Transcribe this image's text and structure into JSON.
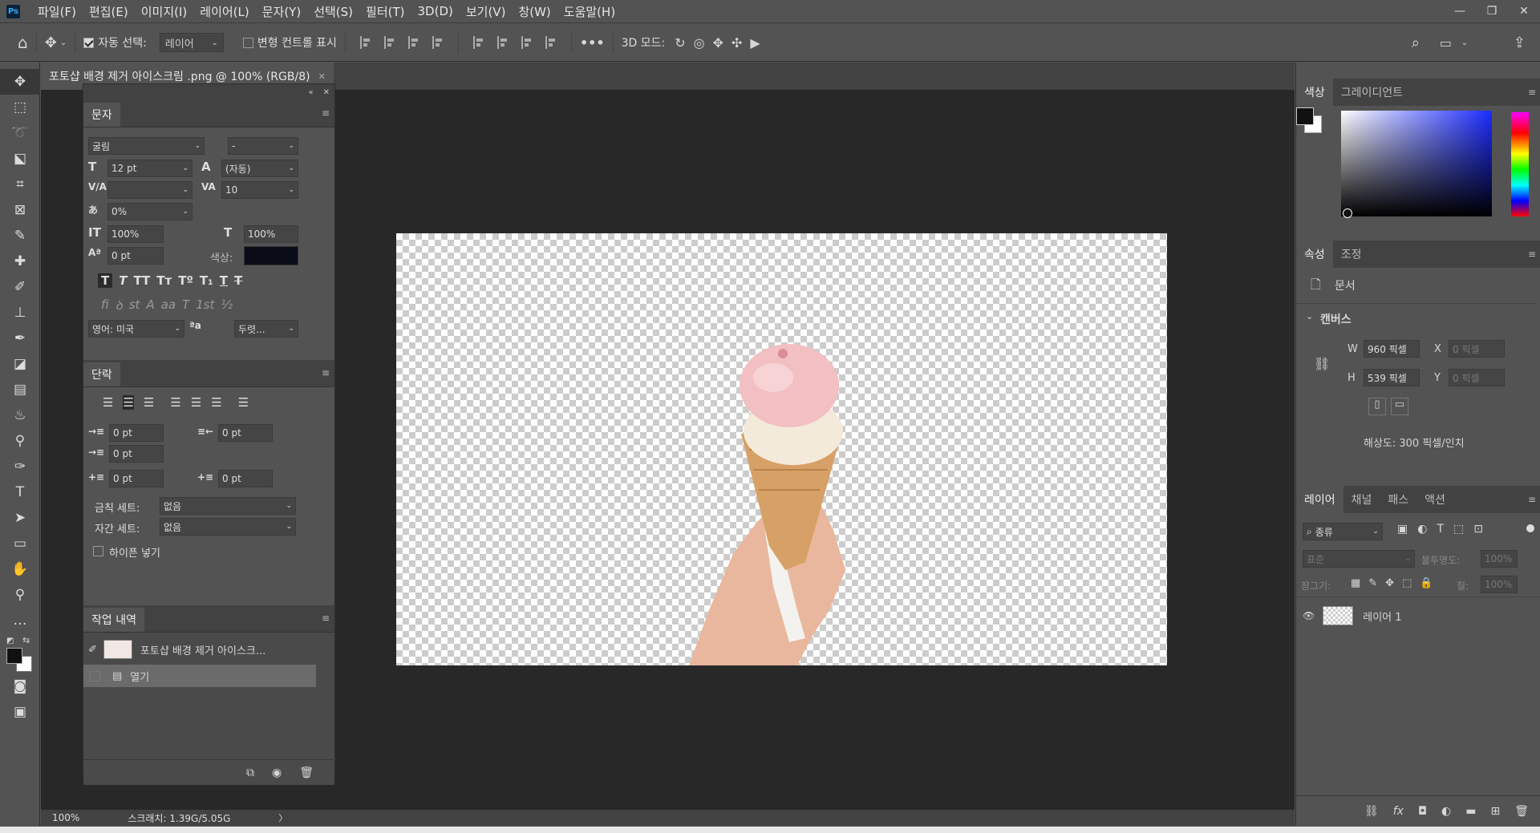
{
  "menu": {
    "logo": "Ps",
    "items": [
      "파일(F)",
      "편집(E)",
      "이미지(I)",
      "레이어(L)",
      "문자(Y)",
      "선택(S)",
      "필터(T)",
      "3D(D)",
      "보기(V)",
      "창(W)",
      "도움말(H)"
    ]
  },
  "window_controls": {
    "minimize": "—",
    "restore": "❐",
    "close": "✕"
  },
  "options": {
    "auto_select_label": "자동 선택:",
    "auto_select_value": "레이어",
    "transform_label": "변형 컨트롤 표시",
    "more": "•••",
    "mode3d_label": "3D 모드:"
  },
  "document": {
    "tab_title": "포토샵 배경 제거 아이스크림 .png @ 100% (RGB/8)",
    "zoom": "100%",
    "scratch": "스크래치: 1.39G/5.05G"
  },
  "character": {
    "tab": "문자",
    "font_family": "굴림",
    "font_style": "-",
    "size": "12 pt",
    "leading": "(자동)",
    "kerning": "",
    "tracking": "10",
    "tsume": "0%",
    "vscale": "100%",
    "hscale": "100%",
    "baseline": "0 pt",
    "color_label": "색상:",
    "color": "#0a0d18",
    "language": "영어: 미국",
    "antialias": "두렷...",
    "antialias_icon": "ªa"
  },
  "paragraph": {
    "tab": "단락",
    "indent_left": "0 pt",
    "indent_right": "0 pt",
    "indent_first": "0 pt",
    "space_before": "0 pt",
    "space_after": "0 pt",
    "kinsoku_label": "금칙 세트:",
    "kinsoku_value": "없음",
    "mojikumi_label": "자간 세트:",
    "mojikumi_value": "없음",
    "hyphenate_label": "하이픈 넣기"
  },
  "history": {
    "tab": "작업 내역",
    "items": [
      {
        "label": "포토샵 배경 제거 아이스크..."
      },
      {
        "label": "열기"
      }
    ]
  },
  "color_panel": {
    "tabs": [
      "색상",
      "그레이디언트"
    ],
    "foreground": "#111111",
    "background": "#ffffff"
  },
  "properties": {
    "tabs": [
      "속성",
      "조정"
    ],
    "doc_label": "문서",
    "section": "캔버스",
    "w_label": "W",
    "w_value": "960 픽셀",
    "h_label": "H",
    "h_value": "539 픽셀",
    "x_label": "X",
    "x_value": "0 픽셀",
    "y_label": "Y",
    "y_value": "0 픽셀",
    "resolution": "해상도: 300 픽셀/인치"
  },
  "layers": {
    "tabs": [
      "레이어",
      "채널",
      "패스",
      "액션"
    ],
    "filter": "종류",
    "blend": "표준",
    "opacity_label": "불투명도:",
    "opacity": "100%",
    "lock_label": "잠그기:",
    "fill_label": "칠:",
    "fill": "100%",
    "items": [
      {
        "name": "레이어 1"
      }
    ]
  }
}
